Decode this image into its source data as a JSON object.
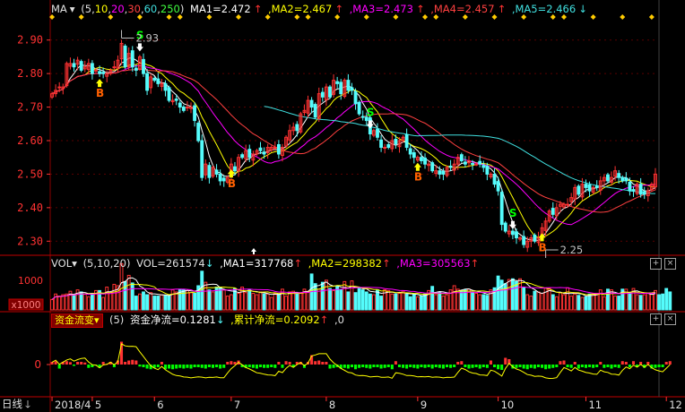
{
  "main_header": {
    "indicator": "MA",
    "params_open": "(",
    "params": [
      "5",
      "10",
      "20",
      "30",
      "60",
      "250"
    ],
    "params_close": ")",
    "ma_values": [
      {
        "label": "MA1=2.472",
        "arrow": "↑",
        "color": "#ffffff"
      },
      {
        "label": ",MA2=2.467",
        "arrow": "↑",
        "color": "#ffff00"
      },
      {
        "label": ",MA3=2.473",
        "arrow": "↑",
        "color": "#ff00ff"
      },
      {
        "label": ",MA4=2.457",
        "arrow": "↑",
        "color": "#ff4040"
      },
      {
        "label": ",MA5=2.466",
        "arrow": "↓",
        "color": "#40e0e0"
      }
    ]
  },
  "vol_header": {
    "indicator": "VOL",
    "params": "(5,10,20)",
    "vol": "VOL=261574",
    "vol_arrow": "↓",
    "ma1": ",MA1=317768",
    "ma1_arrow": "↑",
    "ma2": ",MA2=298382",
    "ma2_arrow": "↑",
    "ma3": ",MA3=305563",
    "ma3_arrow": "↑"
  },
  "flow_header": {
    "indicator_button": "资金流变",
    "param": "(5)",
    "net_flow": "资金净流=0.1281",
    "net_arrow": "↓",
    "cum_flow": ",累计净流=0.2092",
    "cum_arrow": "↑",
    "tail": ",0"
  },
  "period_label": "日线",
  "panel_buttons": [
    "+",
    "×",
    "+",
    "×"
  ],
  "colors": {
    "up": "#ff3232",
    "down": "#54fcfc",
    "ma1": "#ffffff",
    "ma2": "#ffff00",
    "ma3": "#ff00ff",
    "ma4": "#ff4040",
    "ma5": "#40e0e0",
    "grid": "#8b0000",
    "axis_text": "#ff3232",
    "flow_up": "#ff3232",
    "flow_down": "#00ff00"
  },
  "chart_data": {
    "type": "candlestick",
    "y_ticks": [
      "2.90",
      "2.80",
      "2.70",
      "2.60",
      "2.50",
      "2.40",
      "2.30"
    ],
    "ylim": [
      2.25,
      2.95
    ],
    "x_labels": [
      "2018/4",
      "5",
      "6",
      "7",
      "8",
      "9",
      "10",
      "11",
      "12"
    ],
    "x_label_index": [
      0,
      11,
      28,
      49,
      75,
      100,
      122,
      146,
      168
    ],
    "annotations": [
      {
        "text": "2.93",
        "index": 19,
        "value": 2.93
      },
      {
        "text": "2.25",
        "index": 135,
        "value": 2.25
      }
    ],
    "signals": [
      {
        "label": "B",
        "index": 13
      },
      {
        "label": "S",
        "index": 24
      },
      {
        "label": "B",
        "index": 49
      },
      {
        "label": "S",
        "index": 87
      },
      {
        "label": "B",
        "index": 100
      },
      {
        "label": "S",
        "index": 126
      },
      {
        "label": "B",
        "index": 134
      }
    ],
    "closes": [
      2.74,
      2.75,
      2.76,
      2.76,
      2.83,
      2.83,
      2.82,
      2.84,
      2.81,
      2.82,
      2.83,
      2.8,
      2.81,
      2.8,
      2.8,
      2.8,
      2.81,
      2.82,
      2.84,
      2.89,
      2.82,
      2.86,
      2.82,
      2.81,
      2.85,
      2.8,
      2.75,
      2.79,
      2.78,
      2.77,
      2.77,
      2.75,
      2.72,
      2.72,
      2.72,
      2.7,
      2.69,
      2.7,
      2.7,
      2.66,
      2.6,
      2.49,
      2.53,
      2.49,
      2.52,
      2.5,
      2.48,
      2.48,
      2.49,
      2.53,
      2.51,
      2.55,
      2.55,
      2.57,
      2.55,
      2.56,
      2.57,
      2.57,
      2.56,
      2.58,
      2.58,
      2.58,
      2.56,
      2.58,
      2.61,
      2.63,
      2.64,
      2.63,
      2.68,
      2.69,
      2.72,
      2.7,
      2.67,
      2.74,
      2.73,
      2.76,
      2.73,
      2.78,
      2.77,
      2.74,
      2.78,
      2.75,
      2.75,
      2.71,
      2.68,
      2.67,
      2.66,
      2.62,
      2.63,
      2.61,
      2.58,
      2.58,
      2.58,
      2.6,
      2.59,
      2.6,
      2.61,
      2.58,
      2.56,
      2.55,
      2.55,
      2.54,
      2.53,
      2.53,
      2.51,
      2.51,
      2.5,
      2.5,
      2.52,
      2.52,
      2.53,
      2.55,
      2.54,
      2.53,
      2.54,
      2.53,
      2.53,
      2.53,
      2.52,
      2.5,
      2.5,
      2.47,
      2.45,
      2.35,
      2.33,
      2.33,
      2.32,
      2.31,
      2.31,
      2.29,
      2.3,
      2.31,
      2.3,
      2.31,
      2.34,
      2.36,
      2.39,
      2.38,
      2.4,
      2.41,
      2.41,
      2.41,
      2.43,
      2.46,
      2.44,
      2.47,
      2.46,
      2.45,
      2.46,
      2.46,
      2.48,
      2.49,
      2.48,
      2.49,
      2.51,
      2.49,
      2.48,
      2.48,
      2.45,
      2.45,
      2.47,
      2.44,
      2.44,
      2.45,
      2.47,
      2.5
    ],
    "volumes": [
      150,
      230,
      200,
      220,
      230,
      270,
      210,
      290,
      260,
      230,
      190,
      230,
      280,
      280,
      180,
      330,
      250,
      370,
      350,
      670,
      410,
      500,
      390,
      200,
      230,
      260,
      220,
      250,
      200,
      200,
      220,
      210,
      210,
      290,
      260,
      300,
      290,
      280,
      250,
      240,
      350,
      560,
      400,
      290,
      260,
      330,
      330,
      290,
      200,
      220,
      310,
      240,
      330,
      250,
      290,
      240,
      220,
      260,
      230,
      230,
      180,
      240,
      230,
      300,
      200,
      260,
      270,
      240,
      250,
      300,
      270,
      520,
      380,
      300,
      400,
      430,
      310,
      280,
      340,
      290,
      410,
      260,
      420,
      250,
      310,
      290,
      260,
      230,
      220,
      290,
      200,
      290,
      280,
      230,
      230,
      240,
      270,
      230,
      190,
      230,
      190,
      200,
      230,
      280,
      340,
      220,
      260,
      200,
      220,
      290,
      350,
      300,
      280,
      290,
      300,
      250,
      240,
      220,
      220,
      210,
      290,
      320,
      490,
      430,
      380,
      440,
      450,
      410,
      450,
      330,
      220,
      200,
      270,
      260,
      240,
      320,
      310,
      220,
      190,
      250,
      220,
      320,
      200,
      230,
      210,
      180,
      190,
      230,
      240,
      240,
      290,
      190,
      300,
      290,
      200,
      200,
      300,
      300,
      250,
      310,
      220,
      210,
      220,
      240,
      230,
      280,
      220,
      230,
      310,
      260
    ],
    "flow": [
      0.2,
      0.25,
      -0.3,
      0.2,
      0.25,
      0.18,
      -0.1,
      0.2,
      0.2,
      0.15,
      -0.25,
      -0.2,
      -0.05,
      -0.25,
      0.2,
      0.05,
      0.2,
      -0.2,
      0.3,
      1.7,
      0.2,
      0.3,
      0.35,
      0.3,
      -0.15,
      -0.2,
      -0.3,
      -0.35,
      -0.25,
      -0.2,
      0.2,
      -0.35,
      -0.3,
      -0.35,
      -0.3,
      -0.25,
      -0.3,
      -0.25,
      -0.3,
      -0.2,
      -0.2,
      -0.25,
      -0.3,
      -0.2,
      -0.25,
      -0.2,
      -0.3,
      -0.25,
      0.2,
      0.25,
      0.2,
      0.3,
      -0.2,
      -0.25,
      -0.2,
      -0.25,
      -0.3,
      -0.2,
      -0.25,
      -0.25,
      -0.2,
      -0.25,
      0.2,
      -0.25,
      0.25,
      0.2,
      -0.2,
      0.2,
      0.2,
      -0.25,
      0.2,
      0.7,
      0.25,
      0.3,
      0.2,
      0.2,
      -0.3,
      -0.25,
      -0.2,
      -0.3,
      -0.25,
      -0.3,
      -0.2,
      -0.35,
      -0.25,
      -0.2,
      -0.25,
      -0.3,
      -0.2,
      -0.2,
      -0.3,
      -0.25,
      -0.2,
      -0.35,
      0.25,
      -0.2,
      -0.25,
      -0.3,
      -0.2,
      -0.25,
      -0.3,
      -0.2,
      -0.25,
      -0.2,
      -0.3,
      -0.2,
      -0.25,
      -0.3,
      -0.2,
      -0.25,
      -0.2,
      0.2,
      0.25,
      -0.2,
      -0.3,
      -0.25,
      -0.2,
      -0.3,
      -0.2,
      -0.25,
      0.3,
      -0.2,
      -0.35,
      -0.4,
      0.5,
      0.4,
      -0.3,
      -0.25,
      -0.2,
      -0.3,
      -0.35,
      -0.25,
      -0.3,
      -0.2,
      -0.25,
      -0.35,
      -0.3,
      -0.25,
      -0.2,
      0.25,
      0.3,
      -0.2,
      -0.25,
      0.2,
      -0.3,
      -0.2,
      -0.25,
      -0.2,
      -0.25,
      -0.2,
      0.2,
      -0.25,
      -0.2,
      -0.3,
      -0.2,
      -0.25,
      0.25,
      0.2,
      -0.2,
      0.25,
      -0.2,
      0.2,
      -0.25,
      0.2,
      -0.3,
      -0.25,
      -0.2,
      -0.2,
      0.2,
      0.25
    ]
  }
}
